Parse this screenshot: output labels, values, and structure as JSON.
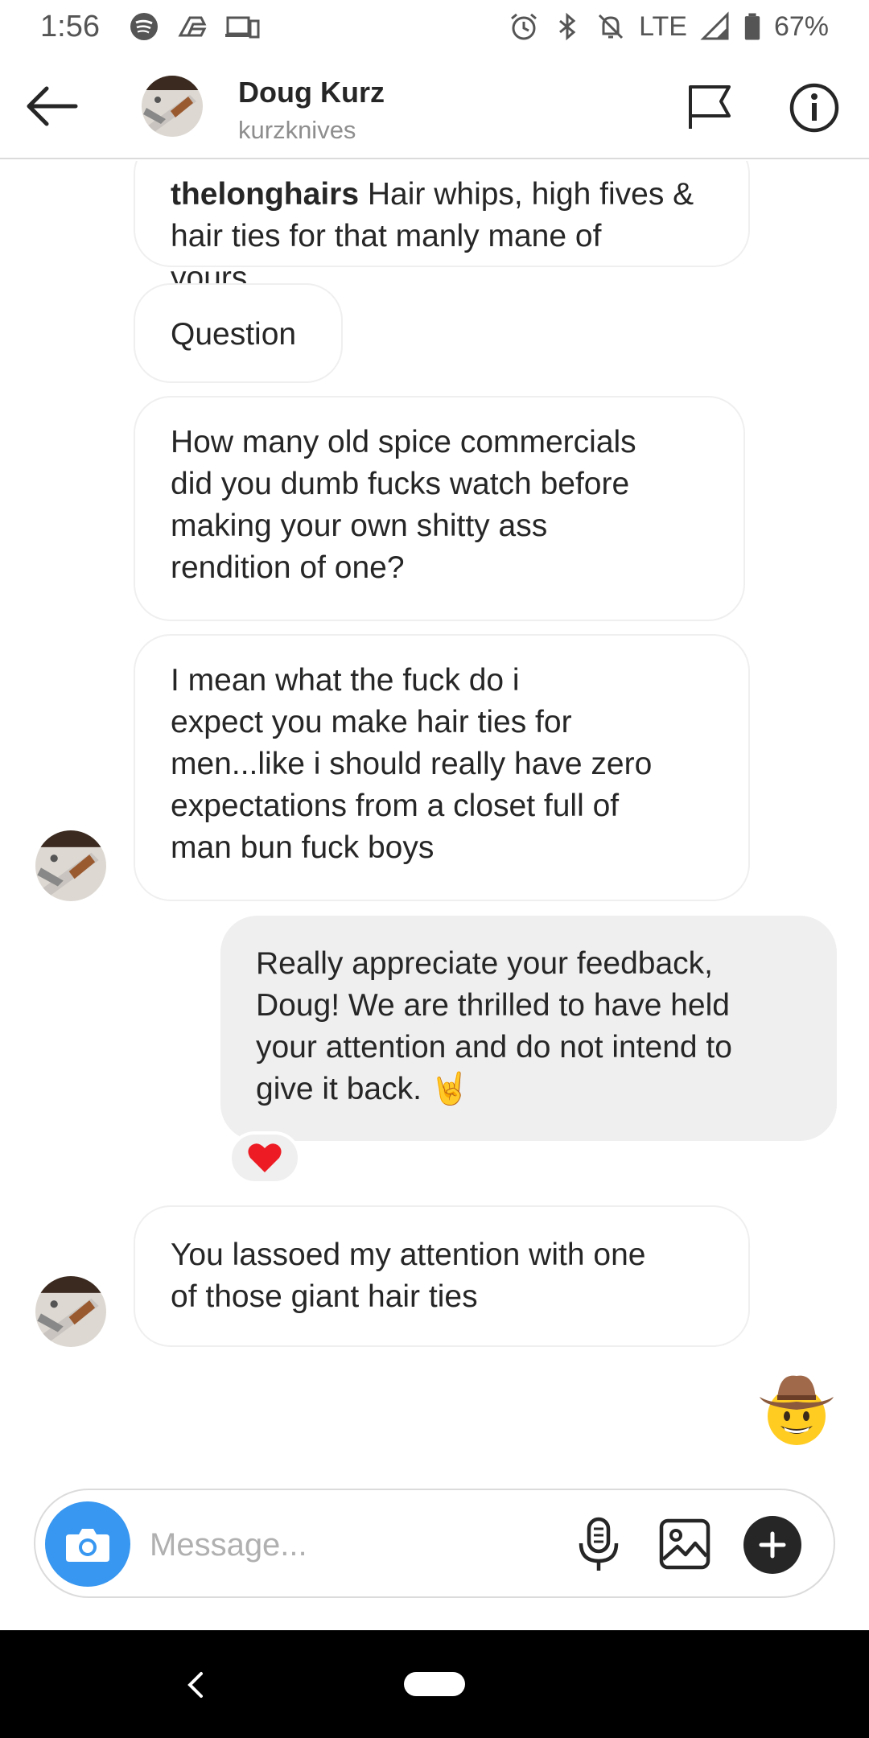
{
  "status_bar": {
    "time": "1:56",
    "network": "LTE",
    "battery": "67%",
    "icons_left": [
      "spotify-icon",
      "drive-icon",
      "devices-icon"
    ],
    "icons_right": [
      "alarm-icon",
      "bluetooth-icon",
      "mute-icon",
      "signal-icon",
      "battery-icon"
    ]
  },
  "header": {
    "name": "Doug Kurz",
    "username": "kurzknives",
    "icons": [
      "back-arrow-icon",
      "flag-icon",
      "info-icon"
    ]
  },
  "messages": [
    {
      "direction": "incoming",
      "username": "thelonghairs",
      "text": " Hair whips, high fives &\nhair ties for that manly mane of yours..."
    },
    {
      "direction": "incoming",
      "text": "Question"
    },
    {
      "direction": "incoming",
      "text": "How many old spice commercials\ndid you dumb fucks watch before\nmaking your own shitty ass\nrendition of one?"
    },
    {
      "direction": "incoming",
      "text": "I mean what the fuck do i\nexpect you make hair ties for\nmen...like i should really have zero\nexpectations from a closet full of\nman bun fuck boys"
    },
    {
      "direction": "outgoing",
      "text": "Really appreciate your feedback,\nDoug! We are thrilled to have held\nyour attention and do not intend to\ngive it back. 🤘",
      "reaction": "heart"
    },
    {
      "direction": "incoming",
      "text": "You lassoed my attention with one\nof those giant hair ties"
    },
    {
      "direction": "incoming",
      "sticker": "cowboy-face"
    }
  ],
  "composer": {
    "placeholder": "Message..."
  },
  "colors": {
    "accent": "#3897f0",
    "reaction_heart": "#ed1c24",
    "outgoing_bubble": "#efefef"
  }
}
